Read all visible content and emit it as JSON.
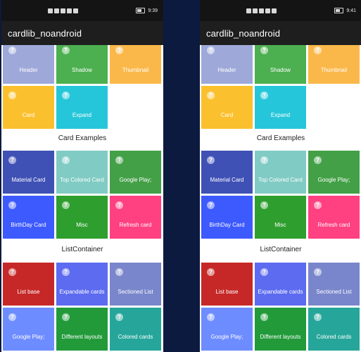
{
  "screens": [
    {
      "time": "9:39",
      "app_title": "cardlib_noandroid",
      "top_tiles": [
        {
          "label": "Header",
          "color": "#9ea9d9"
        },
        {
          "label": "Shadow",
          "color": "#4caf50"
        },
        {
          "label": "Thumbnail",
          "color": "#fbb84a"
        },
        {
          "label": "Card",
          "color": "#fbc02d"
        },
        {
          "label": "Expand",
          "color": "#26c6da"
        }
      ],
      "card_section": "Card Examples",
      "card_tiles": [
        {
          "label": "Material Card",
          "color": "#3f51b5"
        },
        {
          "label": "Top Colored Card",
          "color": "#80cbc4"
        },
        {
          "label": "Google Play;",
          "color": "#43a047"
        },
        {
          "label": "BirthDay Card",
          "color": "#3d5afe"
        },
        {
          "label": "Misc",
          "color": "#2e9e2e"
        },
        {
          "label": "Refresh card",
          "color": "#ff4081"
        }
      ],
      "list_section": "ListContainer",
      "list_tiles": [
        {
          "label": "List base",
          "color": "#c62828"
        },
        {
          "label": "Expandable cards",
          "color": "#5c6bf0"
        },
        {
          "label": "Sectioned List",
          "color": "#7986cb"
        },
        {
          "label": "Google Play;",
          "color": "#6d8cff"
        },
        {
          "label": "Different layouts",
          "color": "#229a3a"
        },
        {
          "label": "Colored cards",
          "color": "#26a69a"
        }
      ]
    },
    {
      "time": "9:41",
      "app_title": "cardlib_noandroid",
      "top_tiles": [
        {
          "label": "Header",
          "color": "#9ea9d9"
        },
        {
          "label": "Shadow",
          "color": "#4caf50"
        },
        {
          "label": "Thumbnail",
          "color": "#fbb84a"
        },
        {
          "label": "Card",
          "color": "#fbc02d"
        },
        {
          "label": "Expand",
          "color": "#26c6da"
        }
      ],
      "card_section": "Card Examples",
      "card_tiles": [
        {
          "label": "Material Card",
          "color": "#3f51b5"
        },
        {
          "label": "Top Colored Card",
          "color": "#80cbc4"
        },
        {
          "label": "Google Play;",
          "color": "#43a047"
        },
        {
          "label": "BirthDay Card",
          "color": "#3d5afe"
        },
        {
          "label": "Misc",
          "color": "#2e9e2e"
        },
        {
          "label": "Refresh card",
          "color": "#ff4081"
        }
      ],
      "list_section": "ListContainer",
      "list_tiles": [
        {
          "label": "List base",
          "color": "#c62828"
        },
        {
          "label": "Expandable cards",
          "color": "#5c6bf0"
        },
        {
          "label": "Sectioned List",
          "color": "#7986cb"
        },
        {
          "label": "Google Play;",
          "color": "#6d8cff"
        },
        {
          "label": "Different layouts",
          "color": "#229a3a"
        },
        {
          "label": "Colored cards",
          "color": "#26a69a"
        }
      ]
    }
  ],
  "help_glyph": "?",
  "icons": [
    "notification-icon",
    "battery-icon",
    "help-icon"
  ]
}
